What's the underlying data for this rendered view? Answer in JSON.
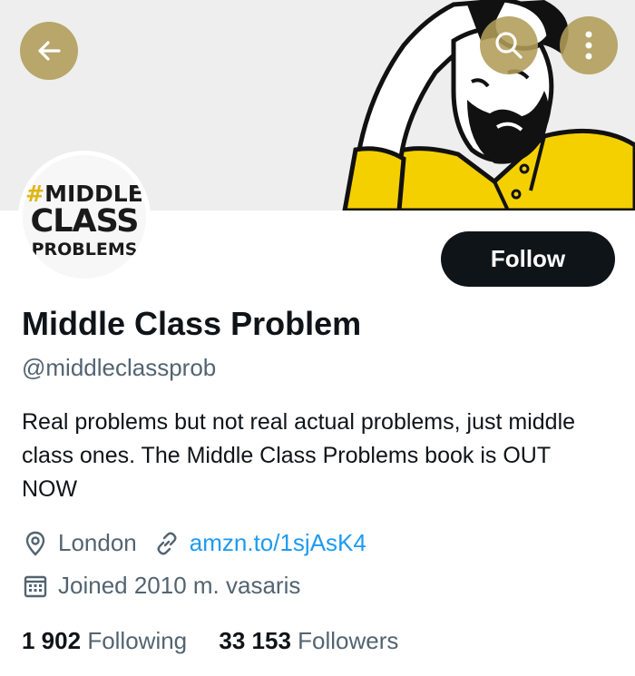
{
  "header": {
    "back_icon": "arrow-left-icon",
    "search_icon": "search-icon",
    "more_icon": "more-vertical-icon",
    "button_color": "#b09c58"
  },
  "banner": {
    "background": "#eeeeee",
    "shirt_color": "#f5d000"
  },
  "avatar": {
    "logo_line1": "#MIDDLE",
    "logo_line2": "CLASS",
    "logo_line3": "PROBLEMS"
  },
  "actions": {
    "follow_label": "Follow"
  },
  "profile": {
    "name": "Middle Class Problem",
    "handle": "@middleclassprob",
    "bio": "Real problems but not real actual problems, just middle class ones. The Middle Class Problems book is OUT NOW",
    "location": "London",
    "link": "amzn.to/1sjAsK4",
    "joined": "Joined 2010 m. vasaris"
  },
  "stats": {
    "following_count": "1 902",
    "following_label": "Following",
    "followers_count": "33 153",
    "followers_label": "Followers"
  },
  "colors": {
    "text": "#0f1419",
    "muted": "#536471",
    "link": "#1d9bf0",
    "follow_bg": "#0f1419"
  }
}
